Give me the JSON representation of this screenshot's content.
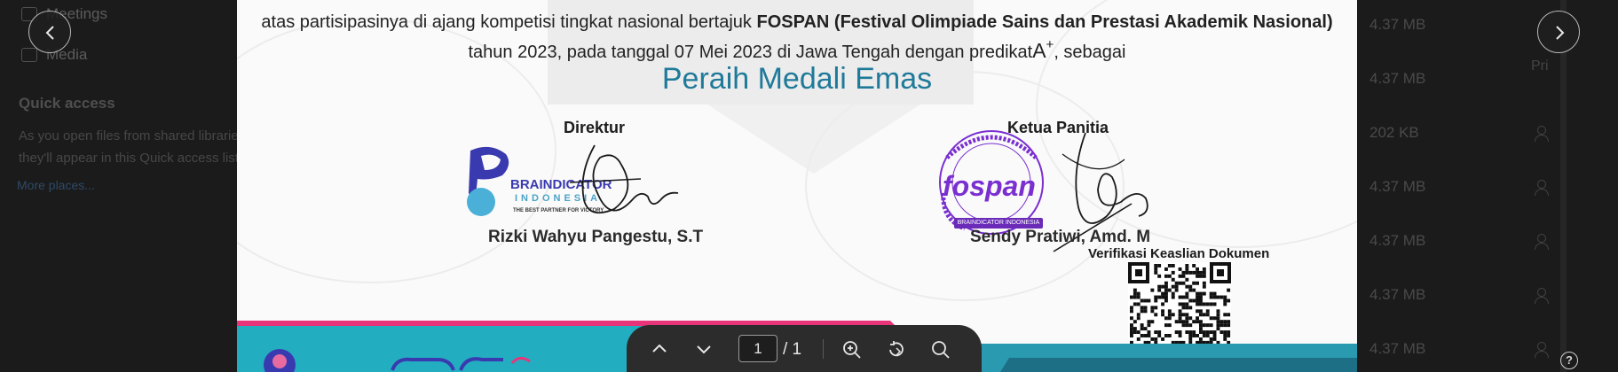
{
  "background_app": {
    "sidebar": {
      "items": [
        {
          "label": "Meetings"
        },
        {
          "label": "Media"
        }
      ],
      "quick_access_title": "Quick access",
      "quick_access_desc_1": "As you open files from shared libraries",
      "quick_access_desc_2": "they'll appear in this Quick access list.",
      "more_places": "More places..."
    },
    "file_rows": [
      {
        "size": "4.37 MB"
      },
      {
        "size": "4.37 MB"
      },
      {
        "size": "202 KB"
      },
      {
        "size": "4.37 MB"
      },
      {
        "size": "4.37 MB"
      },
      {
        "size": "4.37 MB"
      },
      {
        "size": "4.37 MB"
      }
    ],
    "column_fragment": "Pri"
  },
  "viewer": {
    "prev_icon": "chevron-left-icon",
    "next_icon": "chevron-right-icon",
    "current_page": "1",
    "page_total": "/ 1",
    "toolbar_icons": [
      "chevron-up-icon",
      "chevron-down-icon",
      "zoom-in-icon",
      "rotate-icon",
      "search-icon"
    ],
    "help_label": "?"
  },
  "certificate": {
    "line1_prefix": "atas partisipasinya di ajang kompetisi tingkat nasional bertajuk ",
    "line1_event": "FOSPAN (Festival Olimpiade Sains dan Prestasi Akademik Nasional)",
    "line2_prefix": "tahun 2023, pada tanggal 07 Mei 2023 di Jawa Tengah dengan predikat",
    "grade": "A",
    "grade_sup": "+",
    "line2_suffix": ", sebagai",
    "achievement": "Peraih Medali Emas",
    "director_title": "Direktur",
    "director_name": "Rizki Wahyu Pangestu, S.T",
    "chair_title": "Ketua Panitia",
    "chair_name": "Sendy Pratiwi, Amd. M",
    "verify_label": "Verifikasi Keaslian Dokumen",
    "logo_brand": "BRAINDICATOR",
    "logo_country": "INDONESIA",
    "logo_tagline": "THE BEST PARTNER FOR VICTORY",
    "seal_name": "fospan",
    "seal_banner": "BRAINDICATOR INDONESIA",
    "accent_color": "#1f7a9a",
    "band_colors": [
      "#e8357a",
      "#20a8b8"
    ]
  }
}
